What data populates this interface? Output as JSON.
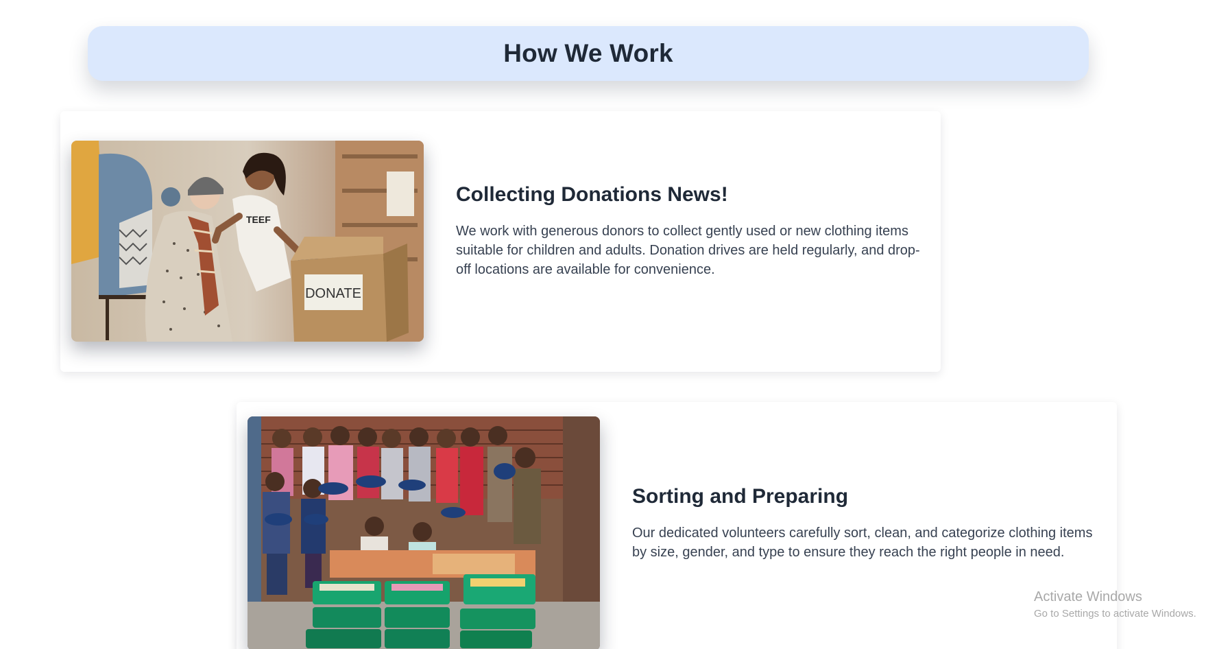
{
  "header": {
    "title": "How We Work"
  },
  "sections": [
    {
      "title": "Collecting Donations News!",
      "description": "We work with generous donors to collect gently used or new clothing items suitable for children and adults. Donation drives are held regularly, and drop-off locations are available for convenience.",
      "image": {
        "sign_text": "DONATE"
      }
    },
    {
      "title": "Sorting and Preparing",
      "description": "Our dedicated volunteers carefully sort, clean, and categorize clothing items by size, gender, and type to ensure they reach the right people in need."
    }
  ],
  "watermark": {
    "title": "Activate Windows",
    "subtitle": "Go to Settings to activate Windows."
  },
  "colors": {
    "header_bg": "#dbe8fd",
    "heading_text": "#1f2937",
    "body_text": "#374151",
    "card_bg": "#ffffff"
  }
}
